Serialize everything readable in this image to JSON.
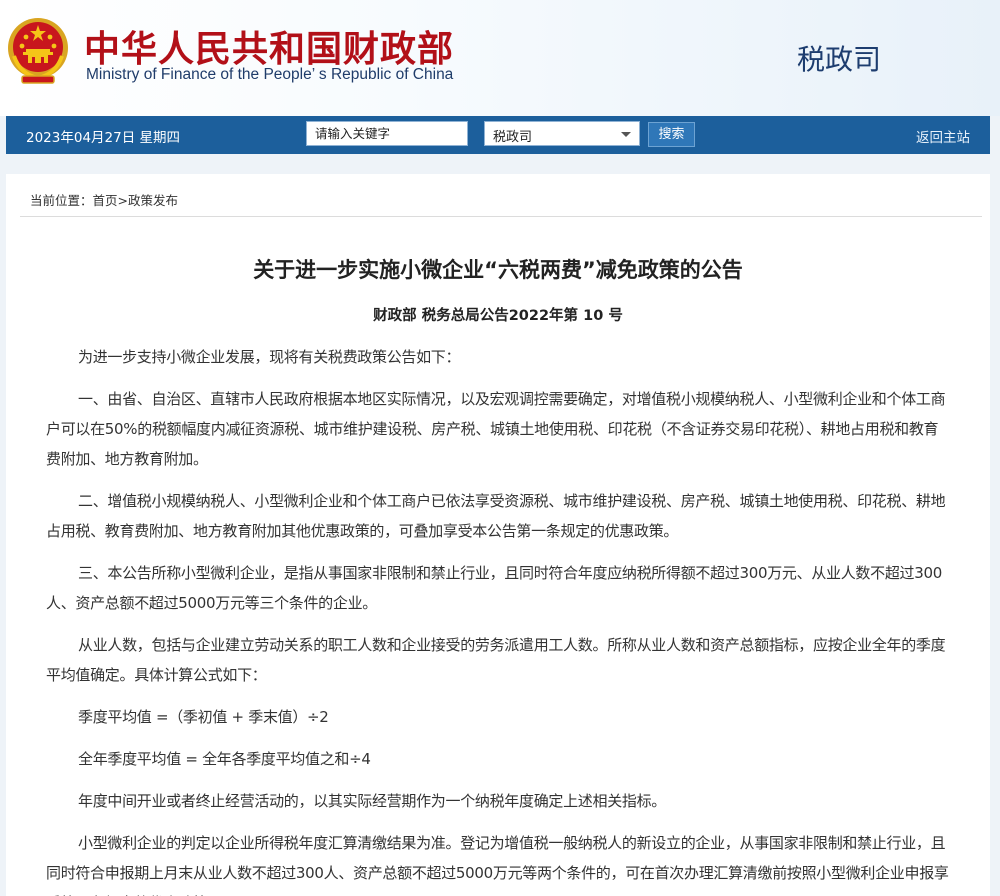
{
  "header": {
    "ministry_cn": "中华人民共和国财政部",
    "ministry_en": "Ministry of Finance of the People’ s Republic of China",
    "department": "税政司"
  },
  "nav": {
    "date": "2023年04月27日  星期四",
    "search_placeholder": "请输入关键字",
    "select_value": "税政司",
    "search_button": "搜索",
    "home_link": "返回主站"
  },
  "breadcrumb": {
    "prefix": "当前位置：",
    "home": "首页",
    "sep": ">",
    "section": "政策发布"
  },
  "article": {
    "title": "关于进一步实施小微企业“六税两费”减免政策的公告",
    "doc_number": "财政部 税务总局公告2022年第 10 号",
    "paragraphs": [
      "为进一步支持小微企业发展，现将有关税费政策公告如下：",
      "一、由省、自治区、直辖市人民政府根据本地区实际情况，以及宏观调控需要确定，对增值税小规模纳税人、小型微利企业和个体工商户可以在50%的税额幅度内减征资源税、城市维护建设税、房产税、城镇土地使用税、印花税（不含证券交易印花税）、耕地占用税和教育费附加、地方教育附加。",
      "二、增值税小规模纳税人、小型微利企业和个体工商户已依法享受资源税、城市维护建设税、房产税、城镇土地使用税、印花税、耕地占用税、教育费附加、地方教育附加其他优惠政策的，可叠加享受本公告第一条规定的优惠政策。",
      "三、本公告所称小型微利企业，是指从事国家非限制和禁止行业，且同时符合年度应纳税所得额不超过300万元、从业人数不超过300人、资产总额不超过5000万元等三个条件的企业。",
      "从业人数，包括与企业建立劳动关系的职工人数和企业接受的劳务派遣用工人数。所称从业人数和资产总额指标，应按企业全年的季度平均值确定。具体计算公式如下：",
      "季度平均值 =（季初值 + 季末值）÷2",
      "全年季度平均值 = 全年各季度平均值之和÷4",
      "年度中间开业或者终止经营活动的，以其实际经营期作为一个纳税年度确定上述相关指标。",
      "小型微利企业的判定以企业所得税年度汇算清缴结果为准。登记为增值税一般纳税人的新设立的企业，从事国家非限制和禁止行业，且同时符合申报期上月末从业人数不超过300人、资产总额不超过5000万元等两个条件的，可在首次办理汇算清缴前按照小型微利企业申报享受第一条规定的优惠政策。"
    ]
  },
  "colors": {
    "navbar": "#1c5f9c",
    "ministry_red": "#b21018",
    "ministry_blue": "#1f3c6a"
  }
}
